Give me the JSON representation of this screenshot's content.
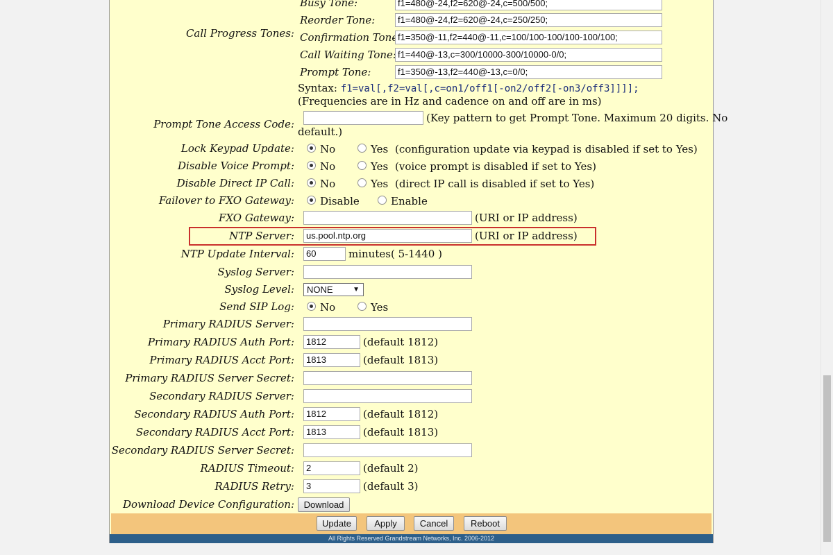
{
  "call_progress": {
    "label": "Call Progress Tones:",
    "busy_label": "Busy Tone:",
    "busy_value": "f1=480@-24,f2=620@-24,c=500/500;",
    "reorder_label": "Reorder Tone:",
    "reorder_value": "f1=480@-24,f2=620@-24,c=250/250;",
    "confirmation_label": "Confirmation Tone:",
    "confirmation_value": "f1=350@-11,f2=440@-11,c=100/100-100/100-100/100;",
    "call_waiting_label": "Call Waiting Tone:",
    "call_waiting_value": "f1=440@-13,c=300/10000-300/10000-0/0;",
    "prompt_label": "Prompt Tone:",
    "prompt_value": "f1=350@-13,f2=440@-13,c=0/0;",
    "syntax_prefix": "Syntax:",
    "syntax_code": "f1=val[,f2=val[,c=on1/off1[-on2/off2[-on3/off3]]]];",
    "syntax_note": "(Frequencies are in Hz and cadence on and off are in ms)"
  },
  "prompt_tone_access": {
    "label": "Prompt Tone Access Code:",
    "value": "",
    "hint_line1": "(Key pattern to get Prompt Tone. Maximum 20 digits. No",
    "hint_line2": "default.)"
  },
  "lock_keypad": {
    "label": "Lock Keypad Update:",
    "opt_no": "No",
    "opt_yes": "Yes",
    "hint": "(configuration update via keypad is disabled if set to Yes)"
  },
  "disable_voice_prompt": {
    "label": "Disable Voice Prompt:",
    "opt_no": "No",
    "opt_yes": "Yes",
    "hint": "(voice prompt is disabled if set to Yes)"
  },
  "disable_direct_ip": {
    "label": "Disable Direct IP Call:",
    "opt_no": "No",
    "opt_yes": "Yes",
    "hint": "(direct IP call is disabled if set to Yes)"
  },
  "failover_fxo": {
    "label": "Failover to FXO Gateway:",
    "opt_disable": "Disable",
    "opt_enable": "Enable"
  },
  "fxo_gateway": {
    "label": "FXO Gateway:",
    "value": "",
    "hint": "(URI or IP address)"
  },
  "ntp_server": {
    "label": "NTP Server:",
    "value": "us.pool.ntp.org",
    "hint": "(URI or IP address)"
  },
  "ntp_interval": {
    "label": "NTP Update Interval:",
    "value": "60",
    "hint": "minutes( 5-1440 )"
  },
  "syslog_server": {
    "label": "Syslog Server:",
    "value": ""
  },
  "syslog_level": {
    "label": "Syslog Level:",
    "value": "NONE"
  },
  "send_sip_log": {
    "label": "Send SIP Log:",
    "opt_no": "No",
    "opt_yes": "Yes"
  },
  "primary_radius_server": {
    "label": "Primary RADIUS Server:",
    "value": ""
  },
  "primary_radius_auth": {
    "label": "Primary RADIUS Auth Port:",
    "value": "1812",
    "hint": "(default 1812)"
  },
  "primary_radius_acct": {
    "label": "Primary RADIUS Acct Port:",
    "value": "1813",
    "hint": "(default 1813)"
  },
  "primary_radius_secret": {
    "label": "Primary RADIUS Server Secret:",
    "value": ""
  },
  "secondary_radius_server": {
    "label": "Secondary RADIUS Server:",
    "value": ""
  },
  "secondary_radius_auth": {
    "label": "Secondary RADIUS Auth Port:",
    "value": "1812",
    "hint": "(default 1812)"
  },
  "secondary_radius_acct": {
    "label": "Secondary RADIUS Acct Port:",
    "value": "1813",
    "hint": "(default 1813)"
  },
  "secondary_radius_secret": {
    "label": "Secondary RADIUS Server Secret:",
    "value": ""
  },
  "radius_timeout": {
    "label": "RADIUS Timeout:",
    "value": "2",
    "hint": "(default 2)"
  },
  "radius_retry": {
    "label": "RADIUS Retry:",
    "value": "3",
    "hint": "(default 3)"
  },
  "download_config": {
    "label": "Download Device Configuration:",
    "button": "Download"
  },
  "actions": {
    "update": "Update",
    "apply": "Apply",
    "cancel": "Cancel",
    "reboot": "Reboot"
  },
  "footer": "All Rights Reserved Grandstream Networks, Inc. 2006-2012"
}
